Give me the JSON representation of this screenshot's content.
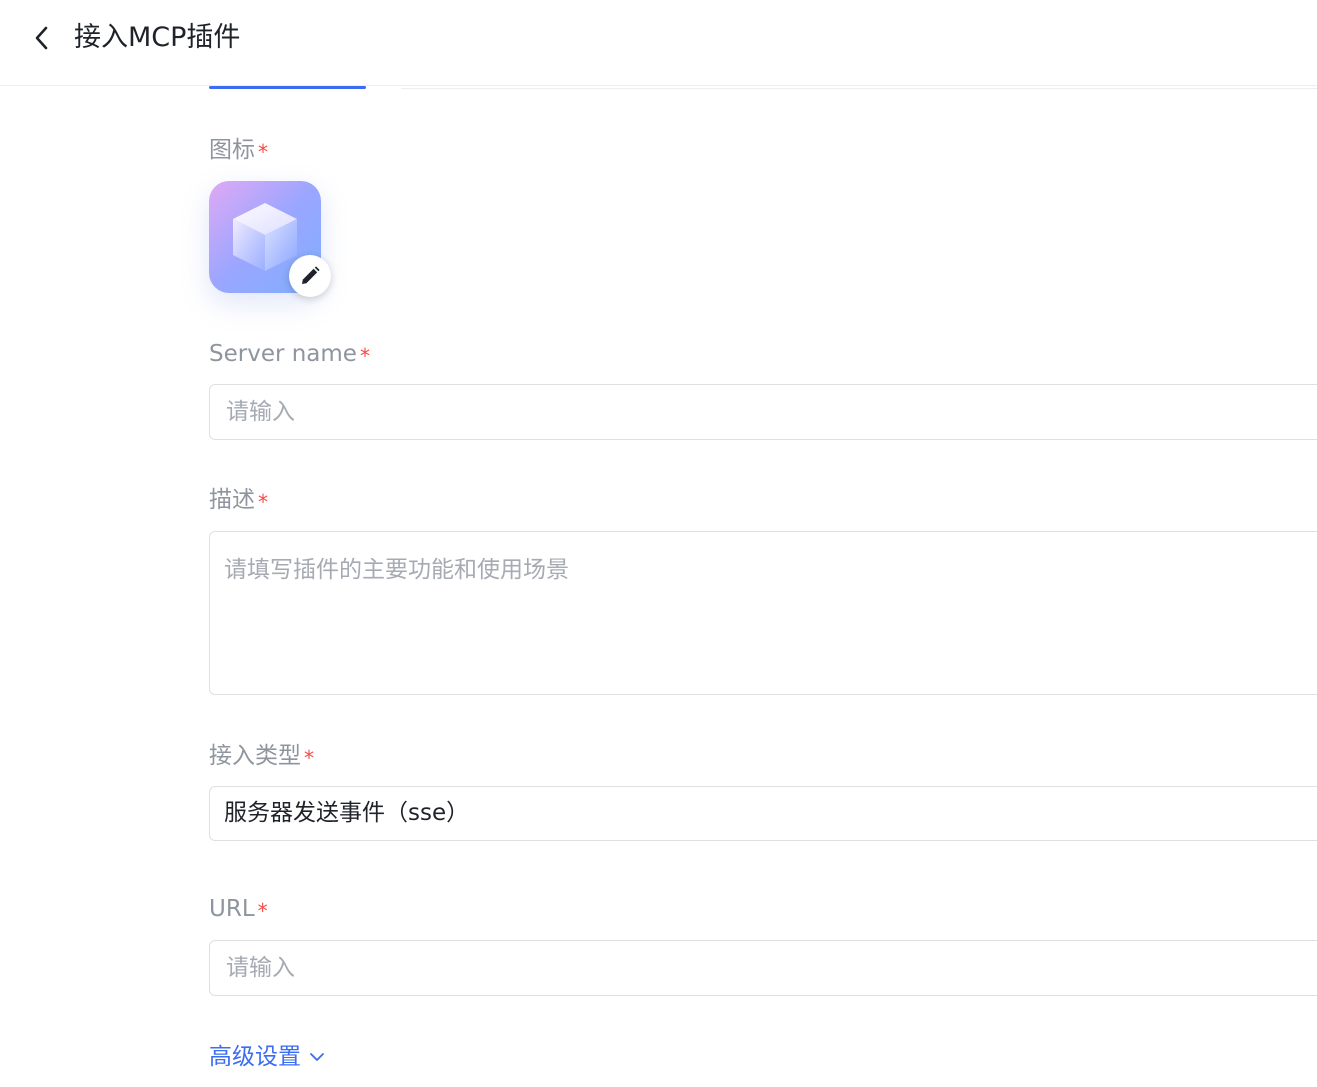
{
  "header": {
    "title": "接入MCP插件"
  },
  "form": {
    "icon": {
      "label": "图标",
      "required_mark": "*"
    },
    "server_name": {
      "label": "Server name",
      "required_mark": "*",
      "placeholder": "请输入",
      "value": ""
    },
    "description": {
      "label": "描述",
      "required_mark": "*",
      "placeholder": "请填写插件的主要功能和使用场景",
      "value": ""
    },
    "access_type": {
      "label": "接入类型",
      "required_mark": "*",
      "selected": "服务器发送事件（sse）"
    },
    "url": {
      "label": "URL",
      "required_mark": "*",
      "placeholder": "请输入",
      "value": ""
    },
    "advanced_settings": {
      "label": "高级设置"
    }
  },
  "colors": {
    "accent": "#3c6cf0",
    "required": "#f54a45",
    "label": "#8f959e",
    "border": "#dee0e3"
  }
}
